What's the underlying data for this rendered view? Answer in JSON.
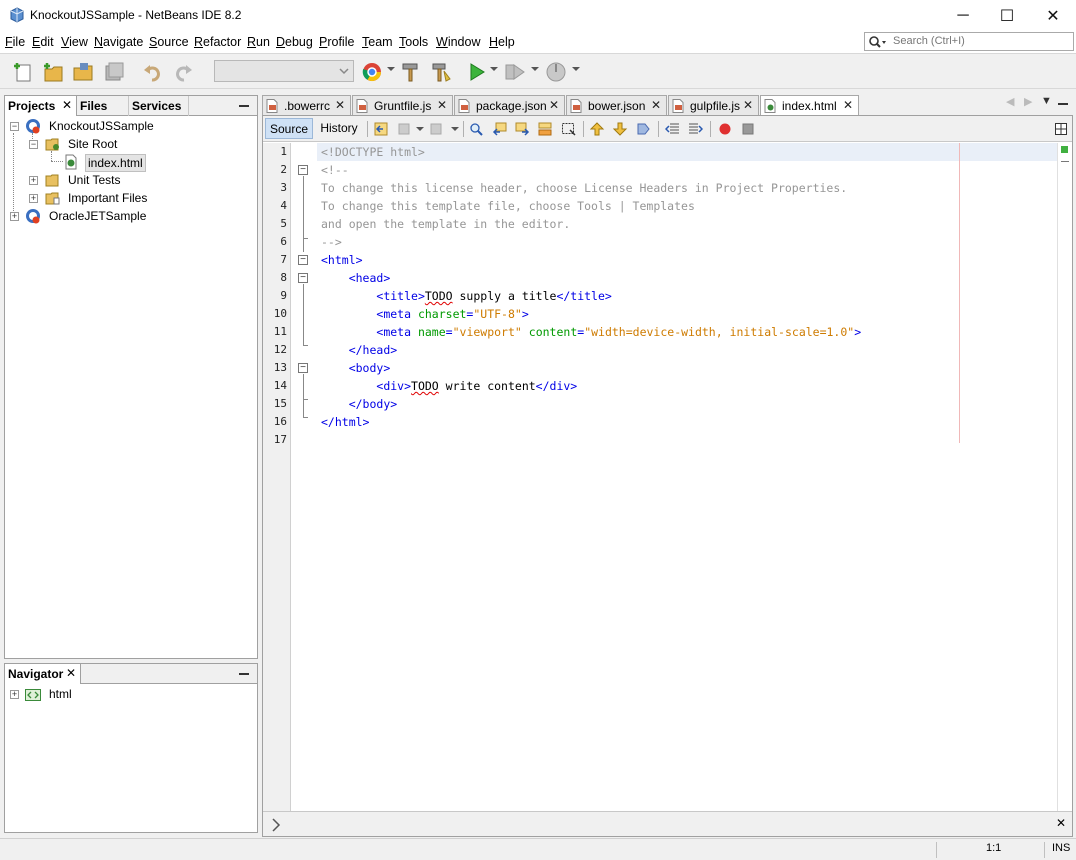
{
  "window": {
    "title": "KnockoutJSSample - NetBeans IDE 8.2",
    "minimize": "─",
    "maximize": "☐",
    "close": "✕"
  },
  "menu": [
    "File",
    "Edit",
    "View",
    "Navigate",
    "Source",
    "Refactor",
    "Run",
    "Debug",
    "Profile",
    "Team",
    "Tools",
    "Window",
    "Help"
  ],
  "search": {
    "placeholder": "Search (Ctrl+I)"
  },
  "projects_panel": {
    "tabs": [
      "Projects",
      "Files",
      "Services"
    ],
    "tree": [
      {
        "label": "KnockoutJSSample",
        "level": 0,
        "expanded": true
      },
      {
        "label": "Site Root",
        "level": 1,
        "expanded": true
      },
      {
        "label": "index.html",
        "level": 2,
        "selected": true
      },
      {
        "label": "Unit Tests",
        "level": 1,
        "expanded": false
      },
      {
        "label": "Important Files",
        "level": 1,
        "expanded": false
      },
      {
        "label": "OracleJETSample",
        "level": 0,
        "expanded": false
      }
    ]
  },
  "navigator_panel": {
    "tab": "Navigator",
    "tree": [
      {
        "label": "html"
      }
    ]
  },
  "editor": {
    "tabs": [
      {
        "label": ".bowerrc",
        "active": false
      },
      {
        "label": "Gruntfile.js",
        "active": false
      },
      {
        "label": "package.json",
        "active": false
      },
      {
        "label": "bower.json",
        "active": false
      },
      {
        "label": "gulpfile.js",
        "active": false
      },
      {
        "label": "index.html",
        "active": true
      }
    ],
    "source_label": "Source",
    "history_label": "History",
    "line_numbers": [
      "1",
      "2",
      "3",
      "4",
      "5",
      "6",
      "7",
      "8",
      "9",
      "10",
      "11",
      "12",
      "13",
      "14",
      "15",
      "16",
      "17"
    ],
    "lines": [
      "<!DOCTYPE html>",
      "<!--",
      "To change this license header, choose License Headers in Project Properties.",
      "To change this template file, choose Tools | Templates",
      "and open the template in the editor.",
      "-->",
      "<html>",
      "    <head>",
      "        <title>TODO supply a title</title>",
      "        <meta charset=\"UTF-8\">",
      "        <meta name=\"viewport\" content=\"width=device-width, initial-scale=1.0\">",
      "    </head>",
      "    <body>",
      "        <div>TODO write content</div>",
      "    </body>",
      "</html>",
      ""
    ]
  },
  "status": {
    "position": "1:1",
    "mode": "INS"
  }
}
